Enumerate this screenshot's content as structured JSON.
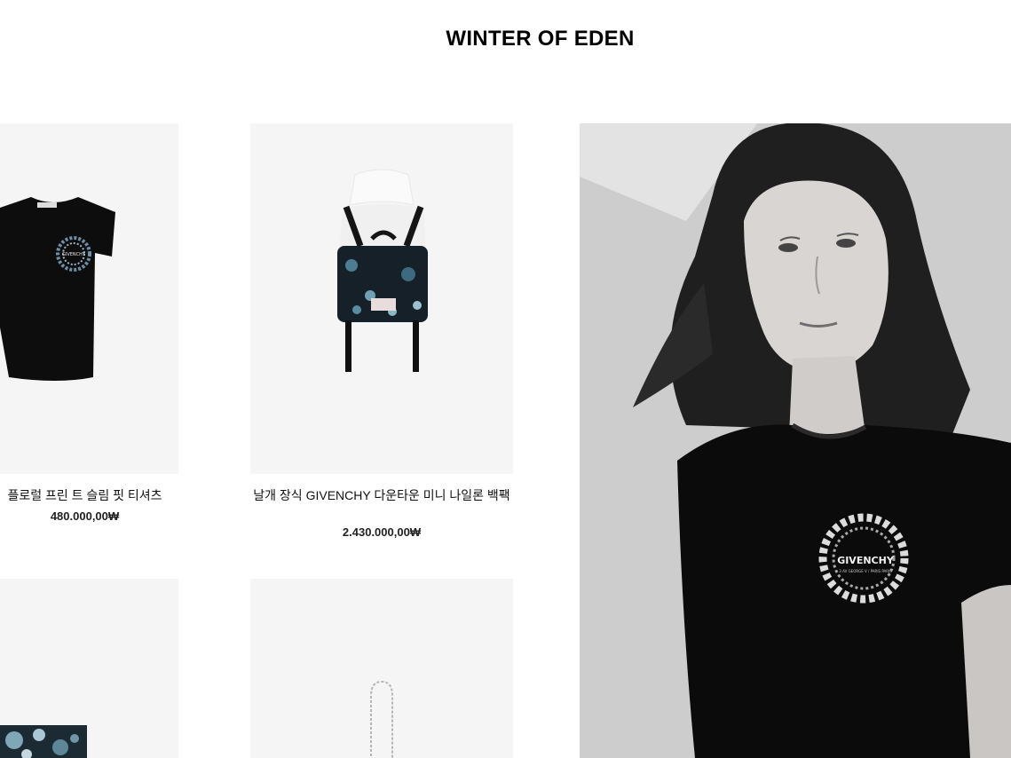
{
  "page": {
    "title": "WINTER OF EDEN"
  },
  "products": [
    {
      "name": "플로럴 프린 트 슬림 핏 티셔츠",
      "price": "480.000,00₩",
      "icon": "tshirt-icon"
    },
    {
      "name": "날개 장식 GIVENCHY 다운타운 미니 나일론 백팩",
      "price": "2.430.000,00₩",
      "icon": "backpack-icon"
    },
    {
      "name": "",
      "price": "",
      "icon": "floral-item-icon"
    },
    {
      "name": "",
      "price": "",
      "icon": "chain-bag-icon"
    }
  ],
  "hero": {
    "logo_text": "GIVENCHY",
    "logo_subtext": "3 AV GEORGE V / PARIS PARIS",
    "image": "model-tshirt-photo"
  },
  "colors": {
    "background": "#ffffff",
    "card_bg": "#f5f5f5",
    "text": "#111111"
  }
}
